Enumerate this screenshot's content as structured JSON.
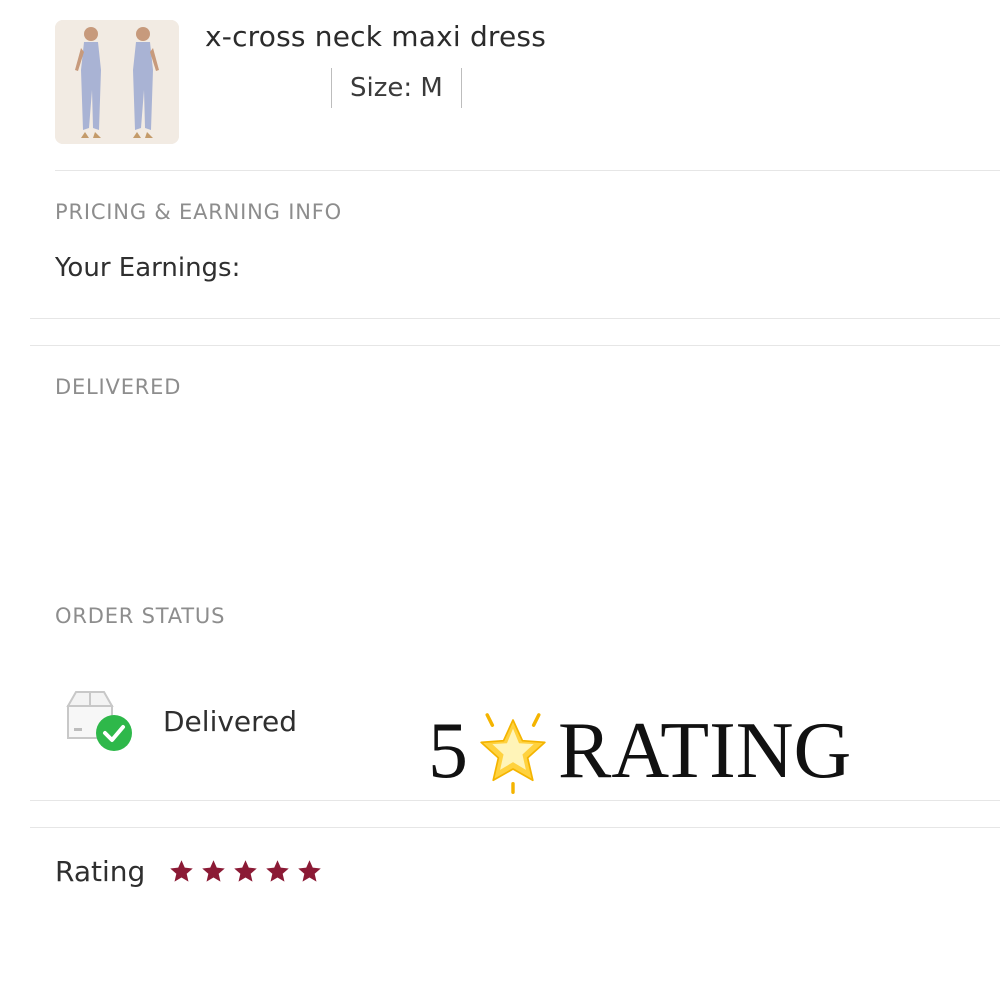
{
  "product": {
    "title": "x-cross neck maxi dress",
    "size_label": "Size: M",
    "thumbnail_icon": "product-photo-icon"
  },
  "pricing": {
    "section_label": "PRICING & EARNING INFO",
    "earnings_label": "Your Earnings:"
  },
  "delivered": {
    "section_label": "DELIVERED"
  },
  "order_status": {
    "section_label": "ORDER STATUS",
    "status_text": "Delivered",
    "status_icon": "package-check-icon",
    "check_color": "#2eb84a"
  },
  "overlay": {
    "number": "5",
    "star_icon": "glowing-star-icon",
    "word": "RATING"
  },
  "rating": {
    "label": "Rating",
    "stars": 5,
    "max_stars": 5,
    "star_color": "#8b1a35"
  }
}
